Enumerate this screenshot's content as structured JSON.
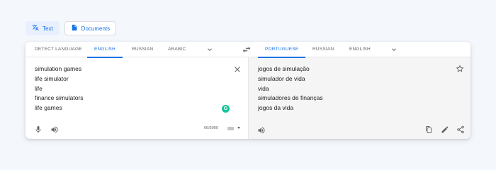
{
  "modes": [
    {
      "label": "Text",
      "icon": "translate-icon",
      "active": true
    },
    {
      "label": "Documents",
      "icon": "document-icon",
      "active": false
    }
  ],
  "source_langs": [
    "DETECT LANGUAGE",
    "ENGLISH",
    "RUSSIAN",
    "ARABIC"
  ],
  "source_selected": "ENGLISH",
  "target_langs": [
    "PORTUGUESE",
    "RUSSIAN",
    "ENGLISH"
  ],
  "target_selected": "PORTUGUESE",
  "source_text": [
    "simulation games",
    "life simulator",
    "life",
    "finance simulators",
    "life games"
  ],
  "translation": [
    "jogos de simulação",
    "simulador de vida",
    "vida",
    "simuladores de finanças",
    "jogos da vida"
  ],
  "char_count": "66/5000",
  "grammarly_letter": "G",
  "colors": {
    "accent": "#1a73e8",
    "page_bg": "#f4f7fc",
    "grammarly": "#15c39a"
  }
}
